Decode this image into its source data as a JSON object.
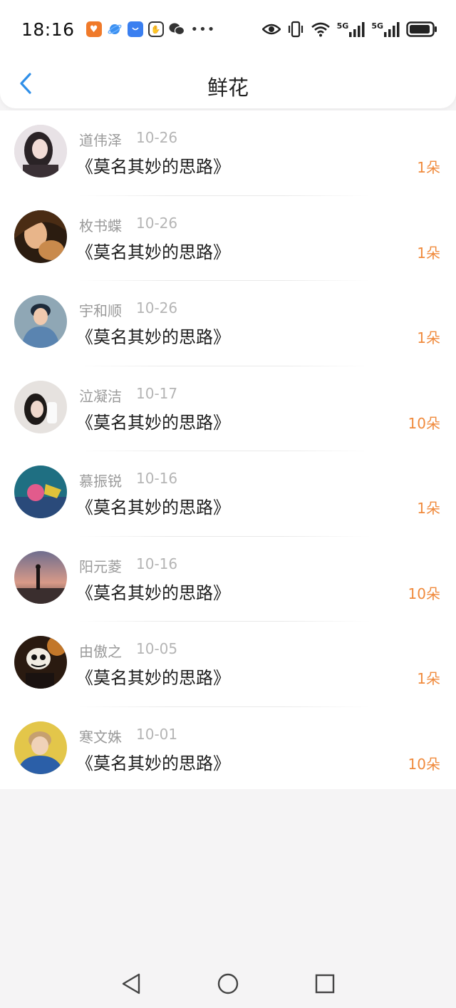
{
  "status": {
    "time": "18:16",
    "network_label": "5G",
    "network_label_2": "5G"
  },
  "header": {
    "title": "鲜花"
  },
  "colors": {
    "accent_blue": "#2f8fe8",
    "count_orange": "#f08a3c",
    "name_gray": "#9a9a9a"
  },
  "items": [
    {
      "name": "道伟泽",
      "date": "10-26",
      "work": "《莫名其妙的思路》",
      "count": "1朵"
    },
    {
      "name": "枚书蝶",
      "date": "10-26",
      "work": "《莫名其妙的思路》",
      "count": "1朵"
    },
    {
      "name": "宇和顺",
      "date": "10-26",
      "work": "《莫名其妙的思路》",
      "count": "1朵"
    },
    {
      "name": "泣凝洁",
      "date": "10-17",
      "work": "《莫名其妙的思路》",
      "count": "10朵"
    },
    {
      "name": "慕振锐",
      "date": "10-16",
      "work": "《莫名其妙的思路》",
      "count": "1朵"
    },
    {
      "name": "阳元菱",
      "date": "10-16",
      "work": "《莫名其妙的思路》",
      "count": "10朵"
    },
    {
      "name": "由傲之",
      "date": "10-05",
      "work": "《莫名其妙的思路》",
      "count": "1朵"
    },
    {
      "name": "寒文姝",
      "date": "10-01",
      "work": "《莫名其妙的思路》",
      "count": "10朵"
    }
  ]
}
